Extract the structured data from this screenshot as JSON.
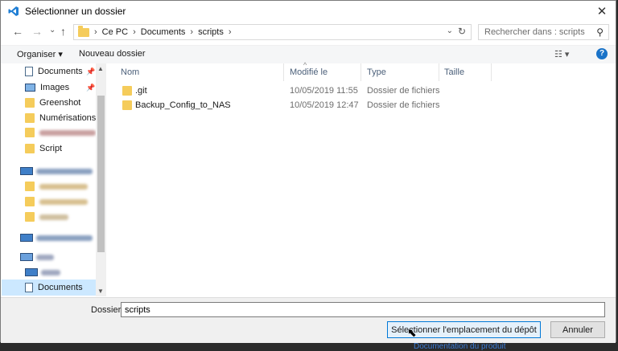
{
  "window": {
    "title": "Sélectionner un dossier",
    "close_glyph": "✕"
  },
  "nav": {
    "back": "←",
    "forward": "→",
    "recent": "⌄",
    "up": "↑",
    "breadcrumbs": [
      "Ce PC",
      "Documents",
      "scripts"
    ],
    "sep": "›",
    "search_placeholder": "Rechercher dans : scripts"
  },
  "toolbar": {
    "organize": "Organiser ▾",
    "new_folder": "Nouveau dossier",
    "help": "?"
  },
  "sidebar": {
    "items": [
      {
        "label": "Documents",
        "icon": "documents-icon",
        "pinned": true
      },
      {
        "label": "Images",
        "icon": "images-icon",
        "pinned": true
      },
      {
        "label": "Greenshot",
        "icon": "folder-icon"
      },
      {
        "label": "Numérisations",
        "icon": "folder-icon"
      },
      {
        "label": "Script",
        "icon": "folder-icon"
      },
      {
        "label": "Documents",
        "icon": "documents-icon",
        "selected": true
      }
    ]
  },
  "columns": {
    "name": "Nom",
    "modified": "Modifié le",
    "type": "Type",
    "size": "Taille"
  },
  "files": [
    {
      "name": ".git",
      "modified": "10/05/2019 11:55",
      "type": "Dossier de fichiers"
    },
    {
      "name": "Backup_Config_to_NAS",
      "modified": "10/05/2019 12:47",
      "type": "Dossier de fichiers"
    }
  ],
  "footer": {
    "folder_label": "Dossier :",
    "folder_value": "scripts",
    "select_button": "Sélectionner l'emplacement du dépôt",
    "cancel_button": "Annuler"
  },
  "background_link": "Documentation du produit",
  "colors": {
    "accent": "#0078d7",
    "folder": "#f5cc5b",
    "selection": "#cce8ff"
  }
}
